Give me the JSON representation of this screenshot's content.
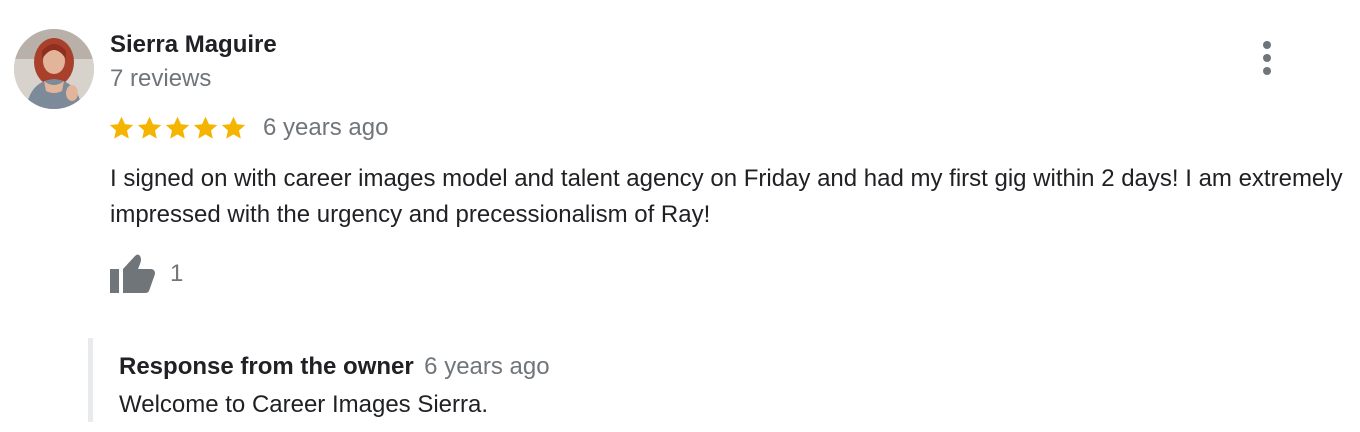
{
  "review": {
    "reviewer_name": "Sierra Maguire",
    "review_count": "7 reviews",
    "rating": 5,
    "rating_max": 5,
    "date": "6 years ago",
    "text": "I signed on with career images model and talent agency on Friday and had my first gig within 2 days! I am extremely impressed with the urgency and precessionalism of Ray!",
    "likes": "1",
    "icons": {
      "avatar": "avatar",
      "star": "star-icon",
      "like": "thumbs-up-icon",
      "more": "more-vert-icon"
    }
  },
  "owner_response": {
    "title": "Response from the owner",
    "date": "6 years ago",
    "text": "Welcome to Career Images Sierra."
  },
  "colors": {
    "star": "#f4b400",
    "secondary_text": "#70757a",
    "primary_text": "#202124",
    "icon_gray": "#70757a",
    "response_border": "#e8eaed"
  }
}
